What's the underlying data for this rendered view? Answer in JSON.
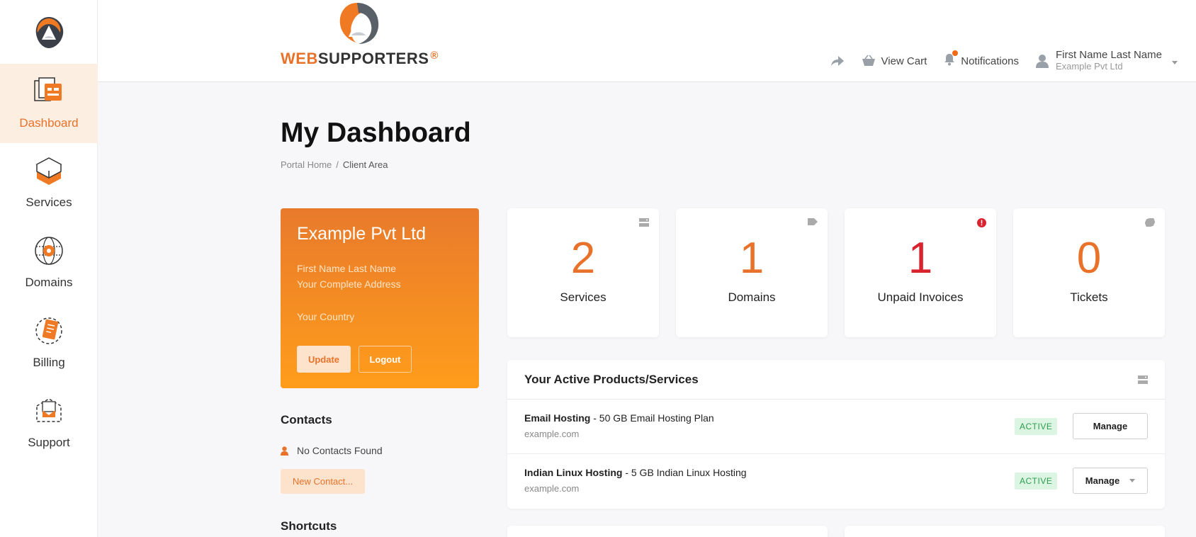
{
  "brand": {
    "word_web": "WEB",
    "word_rest": "SUPPORTERS",
    "registered": "®"
  },
  "sidebar": {
    "items": [
      {
        "label": "Dashboard",
        "icon": "dashboard-icon",
        "active": true
      },
      {
        "label": "Services",
        "icon": "services-box-icon",
        "active": false
      },
      {
        "label": "Domains",
        "icon": "globe-icon",
        "active": false
      },
      {
        "label": "Billing",
        "icon": "billing-icon",
        "active": false
      },
      {
        "label": "Support",
        "icon": "support-icon",
        "active": false
      }
    ]
  },
  "header": {
    "view_cart": "View Cart",
    "notifications": "Notifications",
    "user_name": "First Name Last Name",
    "user_company": "Example Pvt Ltd"
  },
  "page": {
    "title": "My Dashboard",
    "breadcrumb": [
      "Portal Home",
      "Client Area"
    ]
  },
  "client": {
    "company": "Example Pvt Ltd",
    "name": "First Name Last Name",
    "address": "Your Complete Address",
    "country": "Your Country",
    "update_label": "Update",
    "logout_label": "Logout"
  },
  "contacts": {
    "title": "Contacts",
    "empty_text": "No Contacts Found",
    "new_label": "New Contact..."
  },
  "shortcuts": {
    "title": "Shortcuts"
  },
  "stats": [
    {
      "value": "2",
      "label": "Services",
      "icon": "server-icon"
    },
    {
      "value": "1",
      "label": "Domains",
      "icon": "tag-icon"
    },
    {
      "value": "1",
      "label": "Unpaid Invoices",
      "icon": "alert-icon"
    },
    {
      "value": "0",
      "label": "Tickets",
      "icon": "ticket-tag-icon"
    }
  ],
  "products": {
    "title": "Your Active Products/Services",
    "rows": [
      {
        "name": "Email Hosting",
        "plan": " - 50 GB Email Hosting Plan",
        "domain": "example.com",
        "status": "ACTIVE",
        "action": "Manage"
      },
      {
        "name": "Indian Linux Hosting",
        "plan": " - 5 GB Indian Linux Hosting",
        "domain": "example.com",
        "status": "ACTIVE",
        "action": "Manage"
      }
    ]
  },
  "colors": {
    "accent": "#e8722a",
    "danger": "#d9232e",
    "success": "#2e9c4f"
  }
}
